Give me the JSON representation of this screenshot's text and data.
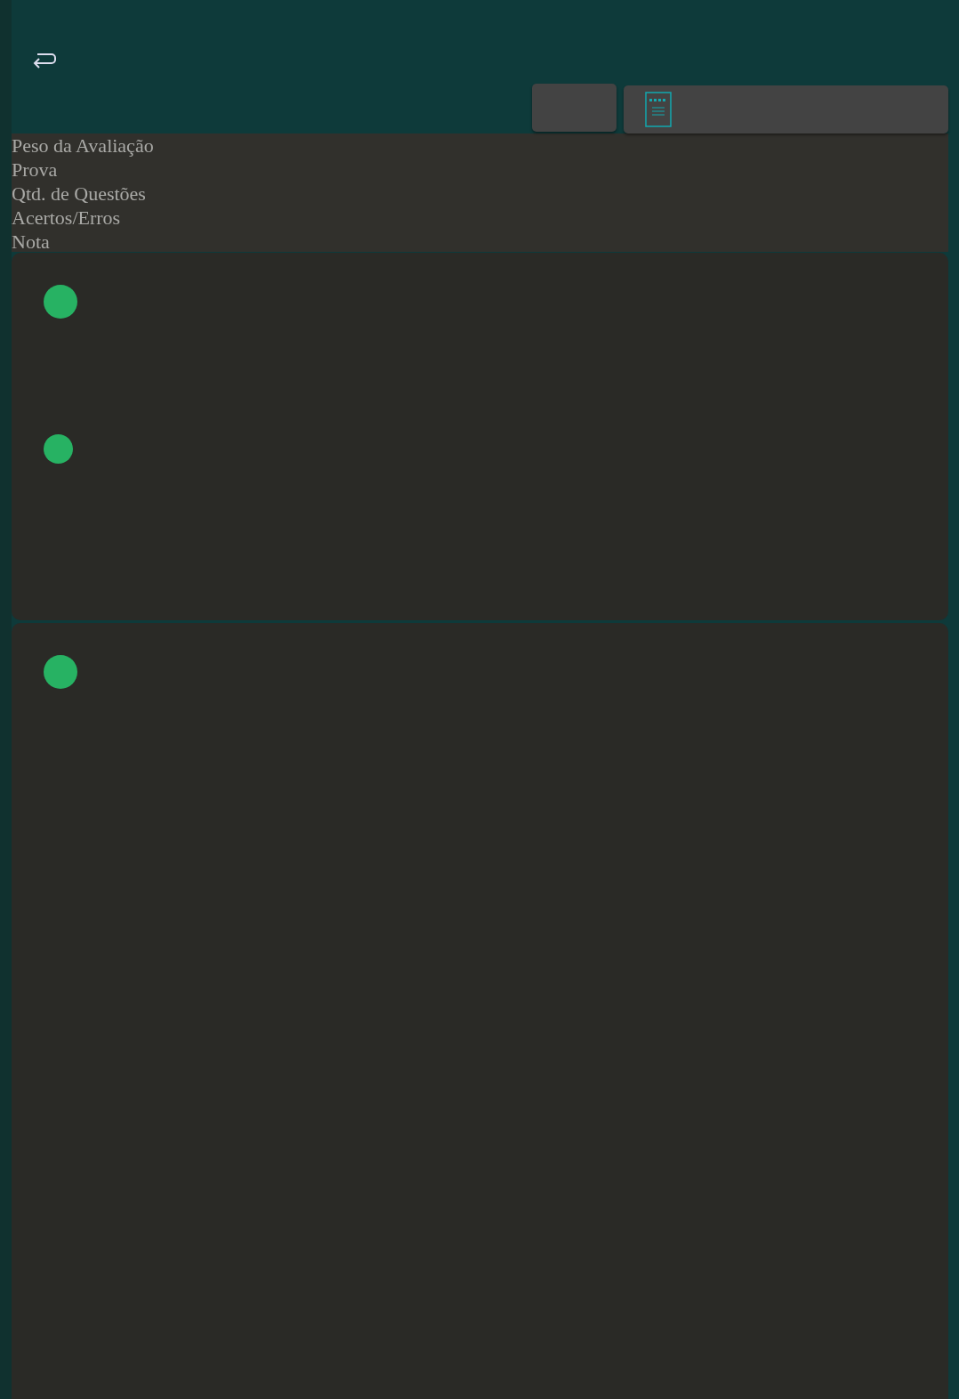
{
  "header_labels": [
    "Peso da Avaliação",
    "Prova",
    "Qtd. de Questões",
    "Acertos/Erros",
    "Nota"
  ],
  "cards": [
    {
      "markers": [
        {
          "kind": "large"
        },
        {
          "kind": "small"
        }
      ]
    },
    {
      "markers": [
        {
          "kind": "large"
        }
      ]
    }
  ]
}
